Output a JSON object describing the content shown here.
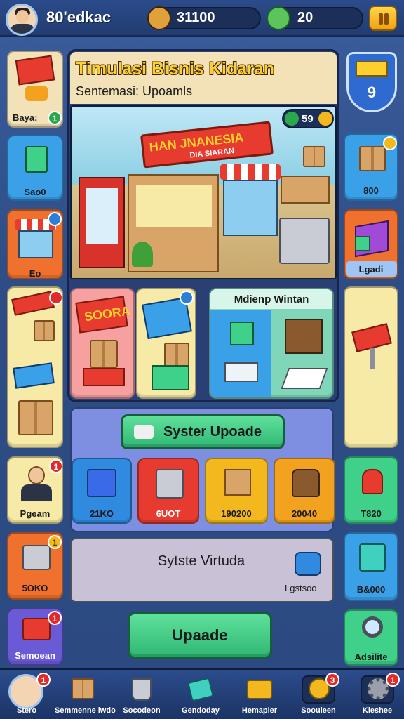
{
  "header": {
    "username": "80'edkac",
    "coins": "31100",
    "gems": "20",
    "pause_icon": "pause-icon"
  },
  "left_column": [
    {
      "label": "Baya:",
      "badge": "1"
    },
    {
      "label": "Sao0"
    },
    {
      "label": "Eo"
    },
    {
      "label": ""
    },
    {
      "label": "Pgeam",
      "badge": "1"
    },
    {
      "label": "5OKO",
      "badge": "1"
    },
    {
      "label": "Semoean",
      "badge": "1"
    }
  ],
  "right_column": [
    {
      "label": "9"
    },
    {
      "label": "800"
    },
    {
      "label": "Lgadi"
    },
    {
      "label": ""
    },
    {
      "label": "T820"
    },
    {
      "label": "B&000"
    },
    {
      "label": "Adsilite"
    }
  ],
  "main": {
    "title": "Timulasi Bisnis Kidaran",
    "subtitle": "Sentemasi: Upoamls",
    "scene_counter": "59",
    "shop_sign": "HAN JNANESIA",
    "shop_sign_sub": "DIA SIARAN",
    "card_a_label": "SOORA",
    "panel_title": "Mdienp Wintan",
    "system_button": "Syster Upoade",
    "resource_tiles": [
      {
        "label": "21KO",
        "color": "#2f8ae0"
      },
      {
        "label": "6UOT",
        "color": "#e63b2e"
      },
      {
        "label": "190200",
        "color": "#f2b81e"
      },
      {
        "label": "20040",
        "color": "#f2a21e"
      }
    ],
    "virtual_title": "Sytste Virtuda",
    "virtual_sub": "Lgstsoo",
    "upgrade_button": "Upaade"
  },
  "bottom_nav": [
    {
      "label": "Stero",
      "icon": "avatar-icon",
      "badge": "1"
    },
    {
      "label": "Semmenne lwdo",
      "icon": "box-icon"
    },
    {
      "label": "Socodeon",
      "icon": "bucket-icon"
    },
    {
      "label": "Gendoday",
      "icon": "tablet-icon"
    },
    {
      "label": "Hemapler",
      "icon": "cash-register-icon"
    },
    {
      "label": "Soouleen",
      "icon": "compass-icon",
      "badge": "3"
    },
    {
      "label": "Kleshee",
      "icon": "gear-icon",
      "badge": "1"
    }
  ],
  "colors": {
    "bg": "#2e4d86",
    "title_yellow": "#ffcf2e",
    "button_green": "#2fb874",
    "badge_red": "#e12a2a"
  }
}
